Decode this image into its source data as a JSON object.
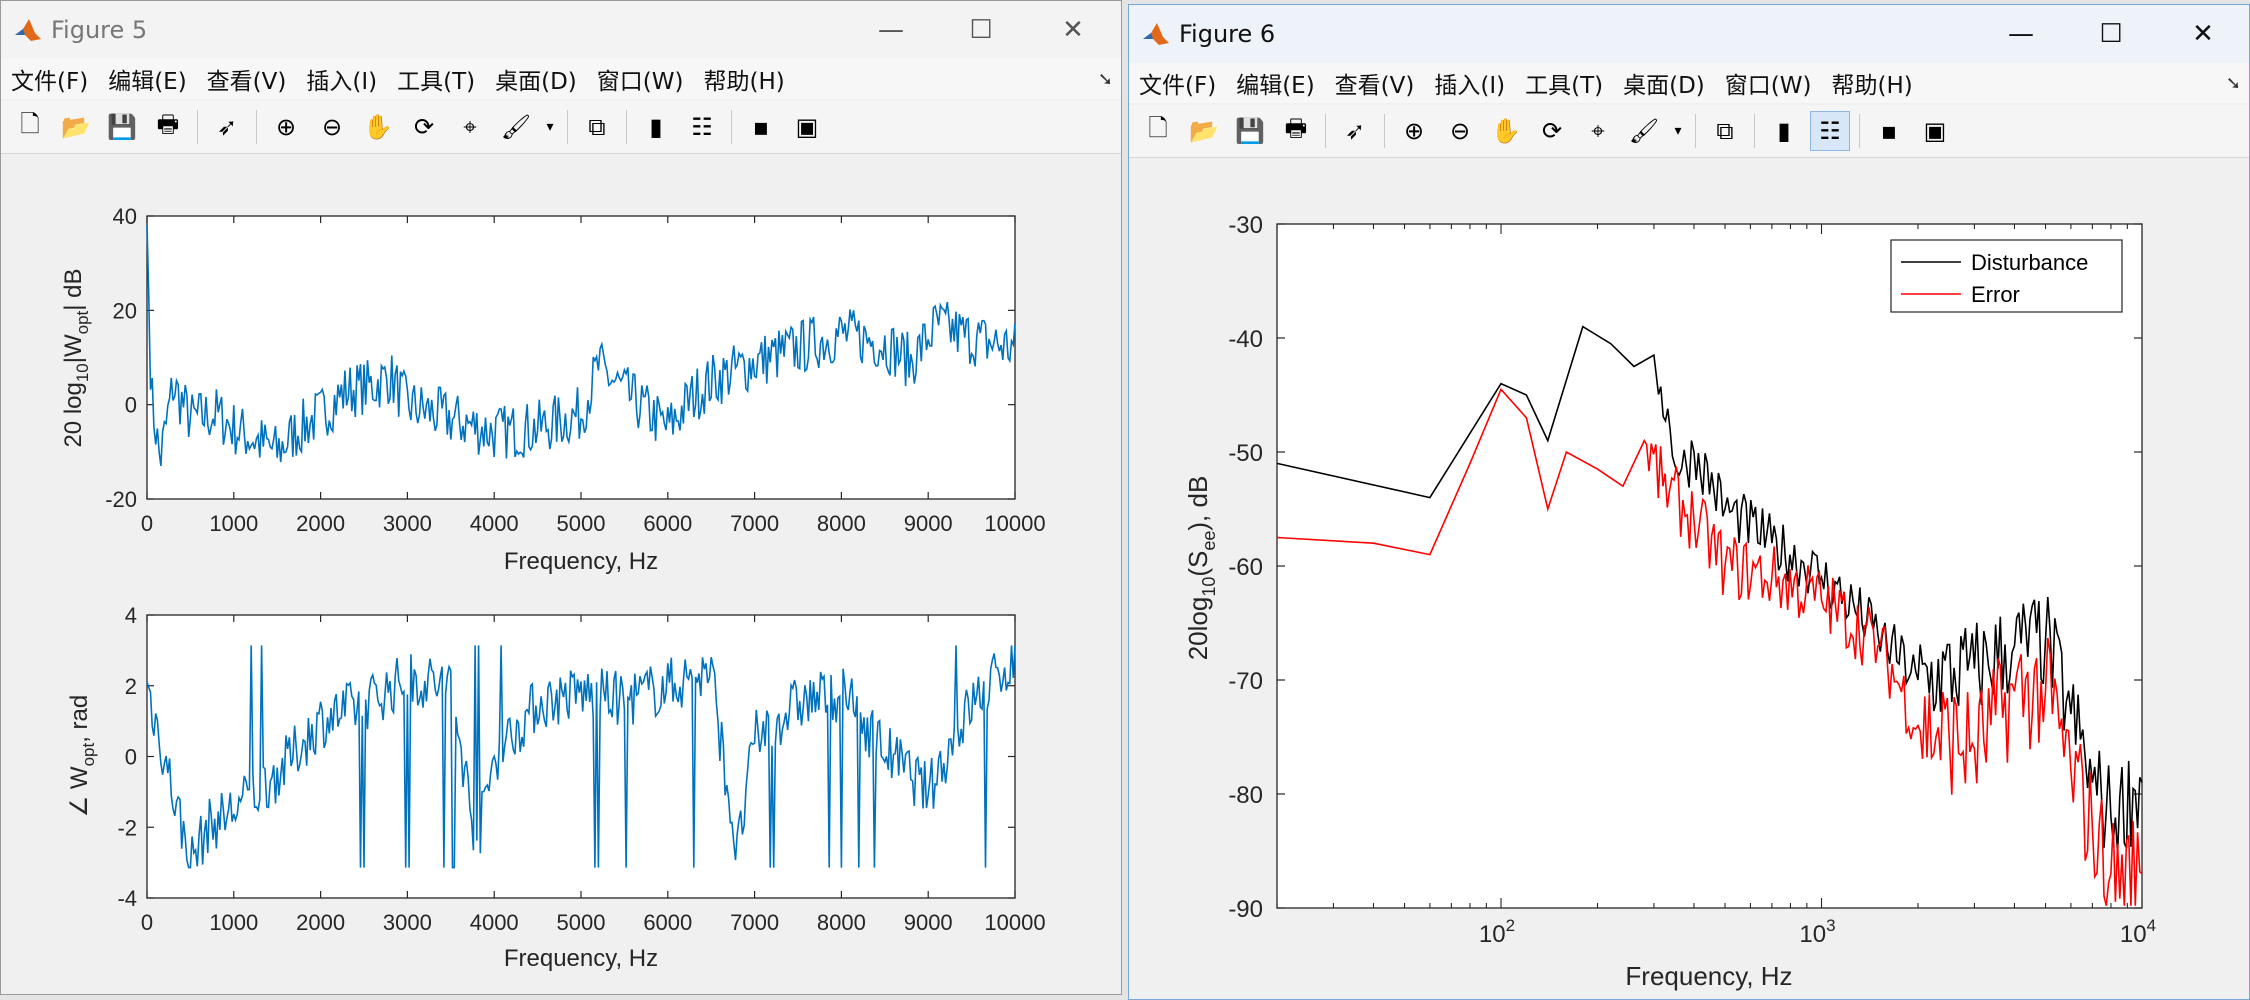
{
  "fig5": {
    "title": "Figure 5",
    "menu": [
      "文件(F)",
      "编辑(E)",
      "查看(V)",
      "插入(I)",
      "工具(T)",
      "桌面(D)",
      "窗口(W)",
      "帮助(H)"
    ],
    "min_glyph": "—",
    "max_glyph": "☐",
    "close_glyph": "✕",
    "chart_top": {
      "ylabel_main": "20 log",
      "ylabel_sub1": "10",
      "ylabel_mid": "|W",
      "ylabel_sub2": "opt",
      "ylabel_end": "| dB",
      "xlabel": "Frequency, Hz",
      "xticks": [
        "0",
        "1000",
        "2000",
        "3000",
        "4000",
        "5000",
        "6000",
        "7000",
        "8000",
        "9000",
        "10000"
      ],
      "yticks": [
        "40",
        "20",
        "0",
        "-20"
      ]
    },
    "chart_bottom": {
      "ylabel_main": "∠ W",
      "ylabel_sub": "opt",
      "ylabel_end": ", rad",
      "xlabel": "Frequency, Hz",
      "xticks": [
        "0",
        "1000",
        "2000",
        "3000",
        "4000",
        "5000",
        "6000",
        "7000",
        "8000",
        "9000",
        "10000"
      ],
      "yticks": [
        "4",
        "2",
        "0",
        "-2",
        "-4"
      ]
    }
  },
  "fig6": {
    "title": "Figure 6",
    "menu": [
      "文件(F)",
      "编辑(E)",
      "查看(V)",
      "插入(I)",
      "工具(T)",
      "桌面(D)",
      "窗口(W)",
      "帮助(H)"
    ],
    "min_glyph": "—",
    "max_glyph": "☐",
    "close_glyph": "✕",
    "chart": {
      "ylabel_main": "20log",
      "ylabel_sub1": "10",
      "ylabel_mid": "(S",
      "ylabel_sub2": "ee",
      "ylabel_end": "), dB",
      "xlabel": "Frequency, Hz",
      "yticks": [
        "-30",
        "-40",
        "-50",
        "-60",
        "-70",
        "-80",
        "-90"
      ],
      "xtick_base": "10",
      "xtick_exps": [
        "2",
        "3",
        "4"
      ],
      "legend": [
        "Disturbance",
        "Error"
      ]
    }
  },
  "colors": {
    "blue": "#0072bd",
    "disturbance": "#000000",
    "error": "#ff0000"
  },
  "chart_data": [
    {
      "type": "line",
      "xlim": [
        0,
        10000
      ],
      "ylim": [
        -20,
        40
      ],
      "xlabel": "Frequency, Hz",
      "ylabel": "20 log10|Wopt| dB",
      "series": [
        {
          "values_x": [
            0,
            50,
            150,
            300,
            500,
            800,
            1000,
            1300,
            1500,
            1700,
            2000,
            2300,
            2600,
            2800,
            3000,
            3500,
            4000,
            4500,
            5000,
            5200,
            5600,
            6000,
            6300,
            6500,
            7000,
            7500,
            8000,
            8500,
            8800,
            9100,
            9500,
            10000
          ],
          "values": [
            38,
            2,
            -12,
            4,
            -3,
            -2,
            -5,
            -8,
            -10,
            -6,
            -2,
            3,
            4,
            6,
            0,
            -3,
            -6,
            -5,
            -2,
            8,
            1,
            -5,
            2,
            5,
            9,
            12,
            15,
            13,
            9,
            17,
            14,
            12
          ]
        }
      ]
    },
    {
      "type": "line",
      "xlim": [
        0,
        10000
      ],
      "ylim": [
        -4,
        4
      ],
      "xlabel": "Frequency, Hz",
      "ylabel": "∠ Wopt, rad",
      "series": [
        {
          "values_x": [
            0,
            500,
            700,
            1000,
            1500,
            2000,
            2500,
            3000,
            3500,
            3800,
            4000,
            4500,
            5000,
            5500,
            6000,
            6500,
            6800,
            7000,
            7500,
            8000,
            8500,
            9000,
            9500,
            10000
          ],
          "values": [
            2,
            -3,
            -2,
            -1.5,
            -0.5,
            1,
            1.5,
            2.2,
            2,
            -2.5,
            0,
            1.5,
            1.8,
            1.6,
            2,
            2.4,
            -2.8,
            0.5,
            1.5,
            1.8,
            0.2,
            -1,
            1.5,
            2.8
          ]
        }
      ]
    },
    {
      "type": "line",
      "xscale": "log",
      "xlim": [
        20,
        10000
      ],
      "ylim": [
        -90,
        -30
      ],
      "xlabel": "Frequency, Hz",
      "ylabel": "20log10(See), dB",
      "legend_position": "top-right",
      "series": [
        {
          "name": "Disturbance",
          "x": [
            20,
            60,
            100,
            120,
            140,
            180,
            220,
            260,
            300,
            360,
            400,
            500,
            700,
            1000,
            1500,
            2000,
            3000,
            4000,
            5000,
            6000,
            7000,
            8000,
            10000
          ],
          "y": [
            -51,
            -54,
            -44,
            -45,
            -49,
            -39,
            -40.5,
            -42.5,
            -41.5,
            -52,
            -50,
            -55,
            -58,
            -61,
            -66,
            -70,
            -69,
            -67,
            -66.5,
            -73,
            -79,
            -82,
            -79
          ]
        },
        {
          "name": "Error",
          "x": [
            20,
            40,
            60,
            80,
            100,
            120,
            140,
            160,
            200,
            240,
            280,
            320,
            400,
            500,
            700,
            1000,
            1500,
            2000,
            3000,
            4000,
            5000,
            6000,
            7000,
            8000,
            10000
          ],
          "y": [
            -57.5,
            -58,
            -59,
            -51,
            -44.5,
            -47,
            -55,
            -50,
            -51.5,
            -53,
            -49,
            -53,
            -56,
            -60,
            -61,
            -63,
            -67,
            -74,
            -76,
            -71,
            -71,
            -78,
            -83,
            -87,
            -87
          ]
        }
      ]
    }
  ]
}
